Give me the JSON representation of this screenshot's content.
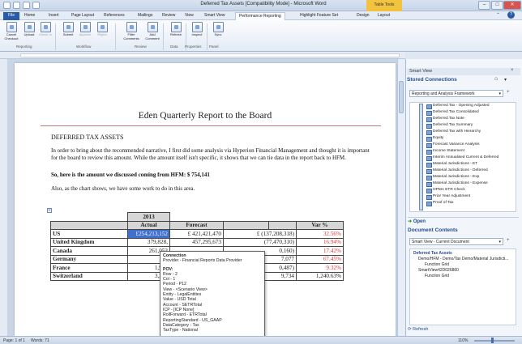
{
  "window": {
    "title": "Deferred Tax Assets [Compatibility Mode] - Microsoft Word",
    "context_tab": "Table Tools",
    "controls": {
      "minimize": "–",
      "maximize": "□",
      "close": "✕"
    }
  },
  "menu": {
    "tabs": [
      "File",
      "Home",
      "Insert",
      "Page Layout",
      "References",
      "Mailings",
      "Review",
      "View",
      "Smart View",
      "Performance Reporting",
      "Highlight Feature Set",
      "Design",
      "Layout"
    ]
  },
  "ribbon": {
    "buttons": [
      "Cancel Checkout",
      "Upload",
      "Check In",
      "Submit",
      "Approve",
      "Reject",
      "Filter Comments",
      "Add Comment",
      "Refresh",
      "Inspect",
      "Sync"
    ],
    "groups": [
      "Reporting",
      "Workflow",
      "Review",
      "Data",
      "Properties",
      "Panel"
    ]
  },
  "document": {
    "title": "Eden Quarterly Report to the Board",
    "heading": "DEFERRED TAX ASSETS",
    "paragraph1": "In order to bring about the recommended narrative, I first did some analysis via Hyperion Financial Management and thought it is important for the board to review this amount.  While the amount itself isn't specific, it shows that we can tie data in the report back to HFM.",
    "paragraph2": "So, here is the amount we discussed coming from HFM:  $  754,141",
    "paragraph3": "Also, as the chart shows, we have some work to do in this area."
  },
  "table": {
    "year": "2013",
    "headers": [
      "Actual",
      "Forecast",
      "",
      "Var %"
    ],
    "rows": [
      {
        "label": "US",
        "actual": "£254,213,152",
        "forecast": "£ 421,421,470",
        "variance": "£ (137,208,318)",
        "pct": "32.56%"
      },
      {
        "label": "United Kingdom",
        "actual": "379,828,",
        "forecast": "457,295,673",
        "variance": "(77,470,310)",
        "pct": "16.94%"
      },
      {
        "label": "Canada",
        "actual": "261,053",
        "forecast": "",
        "variance": "0,160)",
        "pct": "17.42%"
      },
      {
        "label": "Germany",
        "actual": "157",
        "forecast": "",
        "variance": "7,077",
        "pct": "67.45%"
      },
      {
        "label": "France",
        "actual": "1,951",
        "forecast": "",
        "variance": "0,487)",
        "pct": "9.32%"
      },
      {
        "label": "Switzerland",
        "actual": "3,252",
        "forecast": "",
        "variance": "9,734",
        "pct": "1,240.63%"
      }
    ]
  },
  "tooltip": {
    "lines": [
      "Connection",
      "  Provider - Financial Reports Data Provider",
      "",
      "POV:",
      "  Row - 2",
      "  Col - 1",
      "  Period - P12",
      "  View - <Scenario View>",
      "  Entity - LegalEntities",
      "  Value - USD Total",
      "  Account - SETRTotal",
      "  ICP - [ICP None]",
      "  RollForward - ETRTotal",
      "  ReportingStandard - US_GAAP",
      "  DataCategory - Tax",
      "  TaxType - National"
    ]
  },
  "smart_view": {
    "pane_title": "Smart View",
    "section_title": "Stored Connections",
    "connection_select": "Reporting and Analysis Framework",
    "tree_items": [
      "Deferred Tax - Opening Adjusted",
      "Deferred Tax Consolidated",
      "Deferred Tax Note",
      "Deferred Tax Summary",
      "Deferred Tax with Hierarchy",
      "Equity",
      "Forecast Variance Analysis",
      "Income Statement",
      "Interim Annualised Current & Deferred",
      "Material Jurisdictions - ET",
      "Material Jurisdictions - Deferred",
      "Material Jurisdictions - Exp",
      "Material Jurisdictions - Expense",
      "OPMA ETR Check",
      "Prior Year Adjustment",
      "Proof of Tax"
    ],
    "open_label": "Open",
    "document_contents_title": "Document Contents",
    "document_select": "Smart View - Current Document",
    "doc_tree": [
      "Deferred Tax Assets",
      "Demo/HFM - Demo/Tax Demo/Material Jurisdicti...",
      "Function Grid",
      "SmartView42D026860",
      "Function Grid"
    ],
    "refresh_label": "Refresh"
  },
  "status": {
    "page": "Page: 1 of 1",
    "words": "Words: 71",
    "zoom": "110%"
  },
  "colors": {
    "accent": "#2a5ba6",
    "negative": "#e53935",
    "selection": "#3f6fcf",
    "table_header": "#d6d6d6"
  }
}
